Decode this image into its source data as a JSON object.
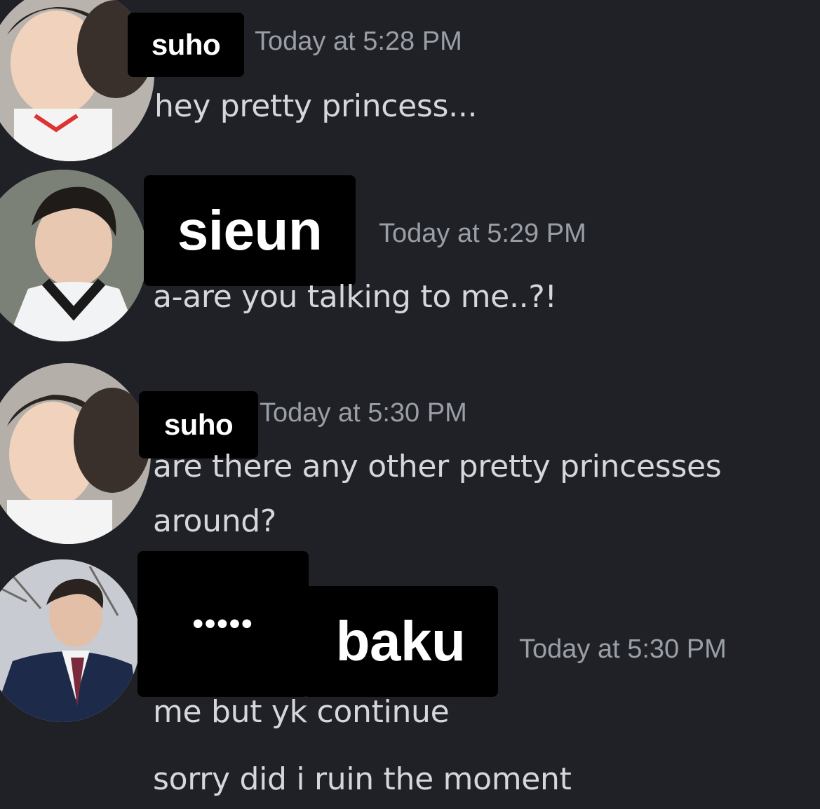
{
  "messages": [
    {
      "author": "suho",
      "timestamp": "Today at 5:28 PM",
      "lines": [
        "hey pretty princess..."
      ],
      "avatar_icon": "avatar-photo-suho"
    },
    {
      "author": "sieun",
      "timestamp": "Today at 5:29 PM",
      "lines": [
        "a-are you talking to me..?!"
      ],
      "avatar_icon": "avatar-photo-sieun"
    },
    {
      "author": "suho",
      "timestamp": "Today at 5:30 PM",
      "lines": [
        "are there any other pretty princesses",
        "around?"
      ],
      "avatar_icon": "avatar-photo-suho"
    },
    {
      "prefix": "•••••",
      "author": "baku",
      "timestamp": "Today at 5:30 PM",
      "lines": [
        "me but yk continue",
        "sorry did i ruin the moment"
      ],
      "avatar_icon": "avatar-photo-baku"
    }
  ],
  "colors": {
    "background": "#1f2126",
    "name_box": "#000000",
    "name_text": "#ffffff",
    "timestamp": "#9a9ea6",
    "message_text": "#d5d7dc"
  }
}
